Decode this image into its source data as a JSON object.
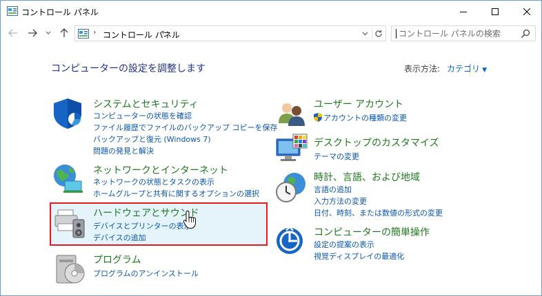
{
  "window": {
    "title": "コントロール パネル",
    "controls": {
      "minimize": "─",
      "maximize": "☐",
      "close": "✕"
    }
  },
  "nav": {
    "back_icon": "←",
    "forward_icon": "→",
    "recent_icon": "˅",
    "up_icon": "↑",
    "breadcrumb": "コントロール パネル",
    "breadcrumb_sep": "›",
    "dropdown_icon": "˅",
    "refresh_icon": "↻"
  },
  "search": {
    "placeholder": "コントロール パネルの検索",
    "value": ""
  },
  "content": {
    "heading": "コンピューターの設定を調整します",
    "view_by": {
      "label": "表示方法:",
      "value": "カテゴリ",
      "arrow": "▼"
    }
  },
  "categories": [
    {
      "title": "システムとセキュリティ",
      "links": [
        "コンピューターの状態を確認",
        "ファイル履歴でファイルのバックアップ コピーを保存",
        "バックアップと復元 (Windows 7)",
        "問題の発見と解決"
      ],
      "icon": "shield-icon"
    },
    {
      "title": "ネットワークとインターネット",
      "links": [
        "ネットワークの状態とタスクの表示",
        "ホームグループと共有に関するオプションの選択"
      ],
      "icon": "network-globe-icon"
    },
    {
      "title": "ハードウェアとサウンド",
      "links": [
        "デバイスとプリンターの表示",
        "デバイスの追加"
      ],
      "icon": "printer-speaker-icon"
    },
    {
      "title": "プログラム",
      "links": [
        "プログラムのアンインストール"
      ],
      "icon": "programs-disc-icon"
    },
    {
      "title": "ユーザー アカウント",
      "links": [
        "アカウントの種類の変更"
      ],
      "icon": "users-icon"
    },
    {
      "title": "デスクトップのカスタマイズ",
      "links": [
        "テーマの変更"
      ],
      "icon": "monitor-palette-icon"
    },
    {
      "title": "時計、言語、および地域",
      "links": [
        "言語の追加",
        "入力方法の変更",
        "日付、時刻、または数値の形式の変更"
      ],
      "icon": "clock-globe-icon"
    },
    {
      "title": "コンピューターの簡単操作",
      "links": [
        "設定の提案の表示",
        "視覚ディスプレイの最適化"
      ],
      "icon": "ease-of-access-icon"
    }
  ],
  "colors": {
    "heading": "#1e3287",
    "category_title": "#1e7a1e",
    "link": "#0a56b0",
    "highlight_border": "#e21a1a",
    "highlight_fill": "#e5f3fb"
  }
}
